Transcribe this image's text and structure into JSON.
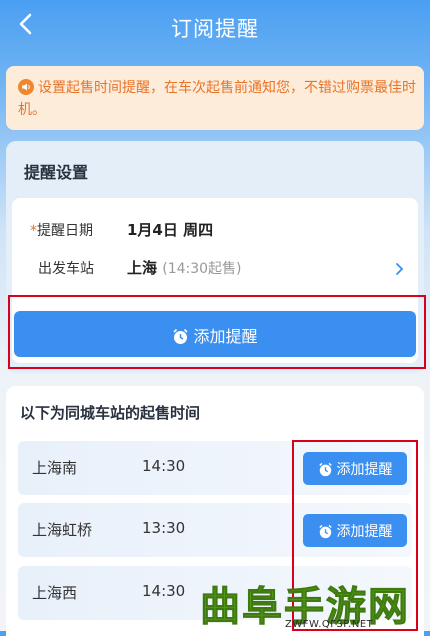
{
  "header": {
    "title": "订阅提醒",
    "back_icon": "back-arrow-icon"
  },
  "notice": {
    "icon": "speaker-icon",
    "text": "设置起售时间提醒，在车次起售前通知您，不错过购票最佳时机。"
  },
  "reminder_settings": {
    "title": "提醒设置",
    "date_required_mark": "*",
    "date_label": "提醒日期",
    "date_value": "1月4日 周四",
    "station_label": "出发车站",
    "station_value": "上海",
    "station_sale_time": "(14:30起售)",
    "add_button_label": "添加提醒"
  },
  "same_city": {
    "title": "以下为同城车站的起售时间",
    "stations": [
      {
        "name": "上海南",
        "time": "14:30",
        "button": "添加提醒"
      },
      {
        "name": "上海虹桥",
        "time": "13:30",
        "button": "添加提醒"
      },
      {
        "name": "上海西",
        "time": "14:30",
        "button": ""
      }
    ]
  },
  "watermark": {
    "logo_text": "曲阜手游网",
    "url": "ZWFW.QFSP.NET"
  },
  "colors": {
    "primary": "#3a8ff0",
    "notice_bg": "#fdecd9",
    "notice_text": "#e8742a",
    "highlight_box": "#d9001b"
  }
}
